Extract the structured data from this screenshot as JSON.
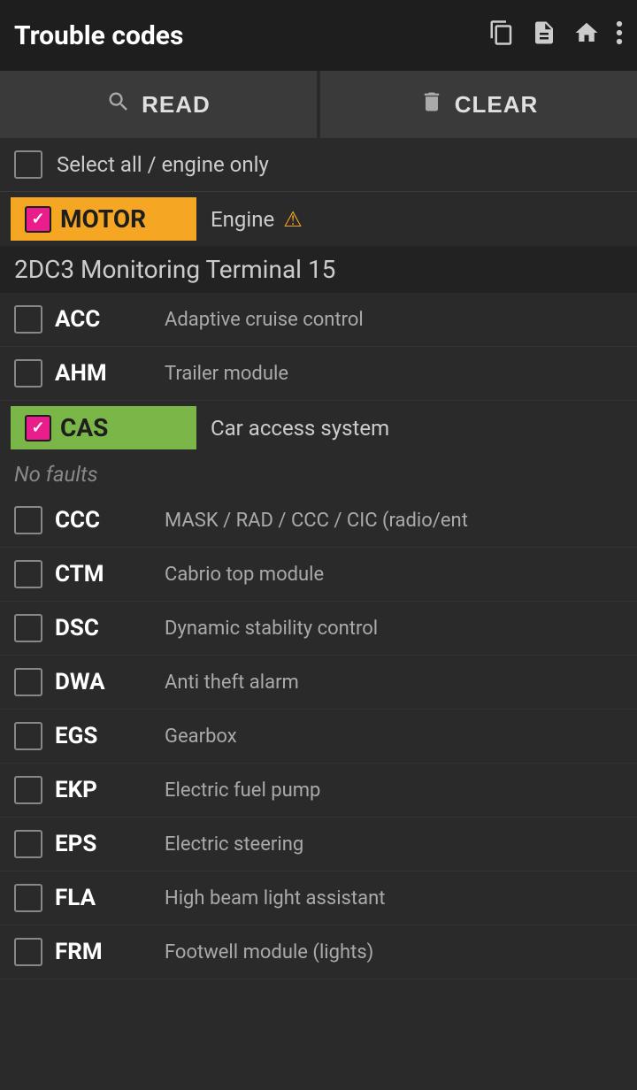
{
  "header": {
    "title": "Trouble codes",
    "icons": [
      "copy",
      "file",
      "home",
      "more-vert"
    ]
  },
  "toolbar": {
    "read_label": "READ",
    "clear_label": "CLEAR"
  },
  "select_all": {
    "label": "Select all / engine only",
    "checked": false
  },
  "modules": [
    {
      "code": "MOTOR",
      "checked": true,
      "color": "orange",
      "description": "Engine",
      "has_warning": true,
      "section_title": "2DC3 Monitoring Terminal 15",
      "items": [
        {
          "code": "ACC",
          "description": "Adaptive cruise control",
          "checked": false
        },
        {
          "code": "AHM",
          "description": "Trailer module",
          "checked": false
        },
        {
          "code": "CAS",
          "description": "Car access system",
          "checked": true,
          "color": "green",
          "status": "No faults"
        },
        {
          "code": "CCC",
          "description": "MASK / RAD / CCC / CIC (radio/ent",
          "checked": false
        },
        {
          "code": "CTM",
          "description": "Cabrio top module",
          "checked": false
        },
        {
          "code": "DSC",
          "description": "Dynamic stability control",
          "checked": false
        },
        {
          "code": "DWA",
          "description": "Anti theft alarm",
          "checked": false
        },
        {
          "code": "EGS",
          "description": "Gearbox",
          "checked": false
        },
        {
          "code": "EKP",
          "description": "Electric fuel pump",
          "checked": false
        },
        {
          "code": "EPS",
          "description": "Electric steering",
          "checked": false
        },
        {
          "code": "FLA",
          "description": "High beam light assistant",
          "checked": false
        },
        {
          "code": "FRM",
          "description": "Footwell module (lights)",
          "checked": false
        }
      ]
    }
  ]
}
